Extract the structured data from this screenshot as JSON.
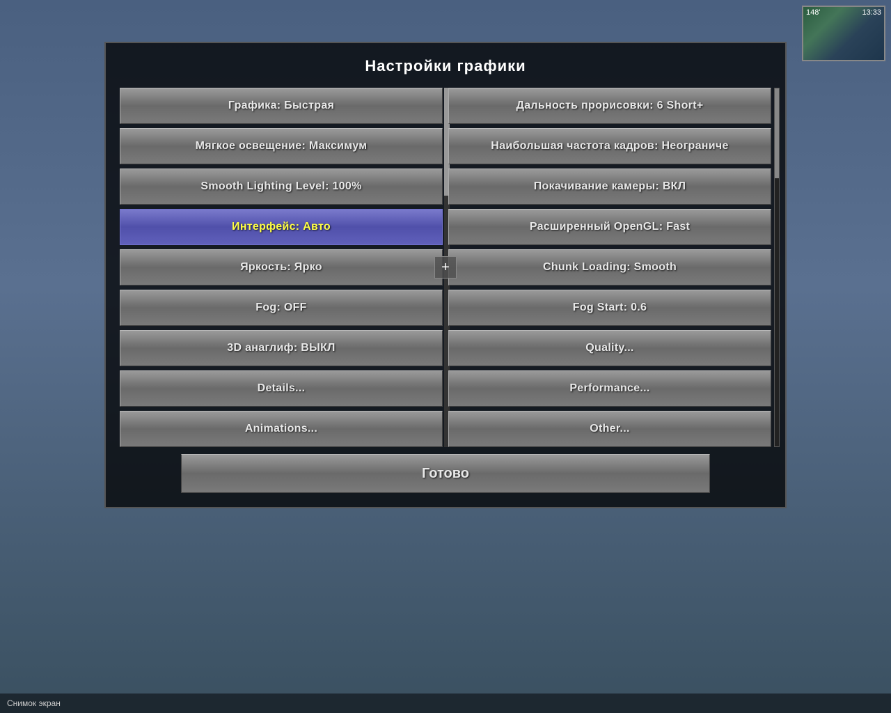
{
  "title": "Настройки графики",
  "minimap": {
    "distance": "148'",
    "time": "13:33"
  },
  "status": {
    "screenshot_label": "Снимок экран"
  },
  "left_column": [
    {
      "id": "graphics",
      "label": "Графика: Быстрая",
      "highlighted": false
    },
    {
      "id": "soft-lighting",
      "label": "Мягкое освещение: Максимум",
      "highlighted": false
    },
    {
      "id": "smooth-lighting-level",
      "label": "Smooth Lighting Level: 100%",
      "highlighted": false
    },
    {
      "id": "interface",
      "label": "Интерфейс: Авто",
      "highlighted": true
    },
    {
      "id": "brightness",
      "label": "Яркость: Ярко",
      "highlighted": false
    },
    {
      "id": "fog",
      "label": "Fog: OFF",
      "highlighted": false
    },
    {
      "id": "3d-anaglyph",
      "label": "3D анаглиф: ВЫКЛ",
      "highlighted": false
    },
    {
      "id": "details",
      "label": "Details...",
      "highlighted": false
    },
    {
      "id": "animations",
      "label": "Animations...",
      "highlighted": false
    }
  ],
  "right_column": [
    {
      "id": "render-distance",
      "label": "Дальность прорисовки: 6 Short+",
      "highlighted": false
    },
    {
      "id": "max-fps",
      "label": "Наибольшая частота кадров: Неограниче",
      "highlighted": false
    },
    {
      "id": "camera-bobbing",
      "label": "Покачивание камеры: ВКЛ",
      "highlighted": false
    },
    {
      "id": "advanced-opengl",
      "label": "Расширенный OpenGL: Fast",
      "highlighted": false
    },
    {
      "id": "chunk-loading",
      "label": "Chunk Loading: Smooth",
      "highlighted": false
    },
    {
      "id": "fog-start",
      "label": "Fog Start: 0.6",
      "highlighted": false
    },
    {
      "id": "quality",
      "label": "Quality...",
      "highlighted": false
    },
    {
      "id": "performance",
      "label": "Performance...",
      "highlighted": false
    },
    {
      "id": "other",
      "label": "Other...",
      "highlighted": false
    }
  ],
  "done_button": "Готово",
  "plus_symbol": "+"
}
